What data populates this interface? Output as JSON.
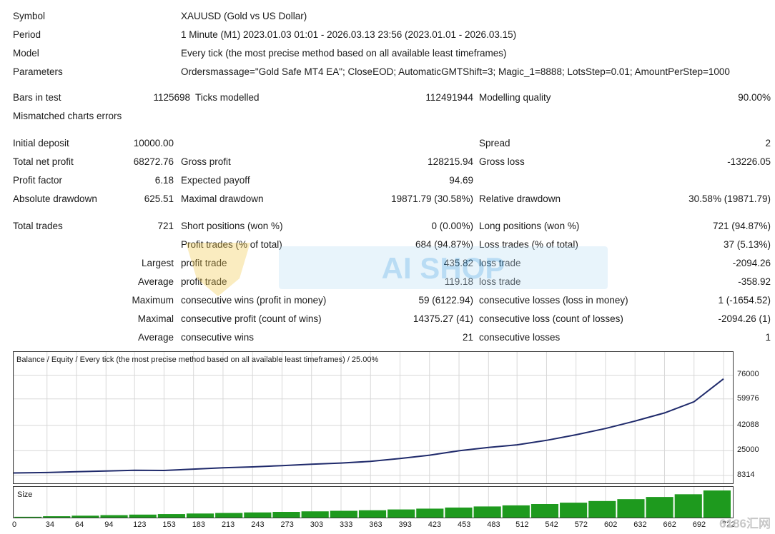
{
  "header": {
    "symbol_label": "Symbol",
    "symbol_value": "XAUUSD (Gold vs US Dollar)",
    "period_label": "Period",
    "period_value": "1 Minute (M1) 2023.01.03 01:01 - 2026.03.13 23:56 (2023.01.01 - 2026.03.15)",
    "model_label": "Model",
    "model_value": "Every tick (the most precise method based on all available least timeframes)",
    "parameters_label": "Parameters",
    "parameters_value": "Ordersmassage=\"Gold Safe MT4 EA\"; CloseEOD; AutomaticGMTShift=3; Magic_1=8888; LotsStep=0.01; AmountPerStep=1000"
  },
  "stats": {
    "bars_label": "Bars in test",
    "bars_value": "1125698",
    "ticks_label": "Ticks modelled",
    "ticks_value": "112491944",
    "quality_label": "Modelling quality",
    "quality_value": "90.00%",
    "mismatched_label": "Mismatched charts errors",
    "mismatched_value": "",
    "deposit_label": "Initial deposit",
    "deposit_value": "10000.00",
    "spread_label": "Spread",
    "spread_value": "2",
    "netprofit_label": "Total net profit",
    "netprofit_value": "68272.76",
    "grossprofit_label": "Gross profit",
    "grossprofit_value": "128215.94",
    "grossloss_label": "Gross loss",
    "grossloss_value": "-13226.05",
    "pf_label": "Profit factor",
    "pf_value": "6.18",
    "expected_label": "Expected payoff",
    "expected_value": "94.69",
    "absdd_label": "Absolute drawdown",
    "absdd_value": "625.51",
    "maxdd_label": "Maximal drawdown",
    "maxdd_value": "19871.79 (30.58%)",
    "reldd_label": "Relative drawdown",
    "reldd_value": "30.58% (19871.79)",
    "trades_label": "Total trades",
    "trades_value": "721",
    "short_label": "Short positions (won %)",
    "short_value": "0 (0.00%)",
    "long_label": "Long positions (won %)",
    "long_value": "721 (94.87%)",
    "pt_label": "Profit trades (% of total)",
    "pt_value": "684 (94.87%)",
    "lt_label": "Loss trades (% of total)",
    "lt_value": "37 (5.13%)",
    "largest_label": "Largest",
    "lp_label": "profit trade",
    "lp_value": "435.82",
    "ll_label": "loss trade",
    "ll_value": "-2094.26",
    "average_label": "Average",
    "ap_label": "profit trade",
    "ap_value": "119.18",
    "al_label": "loss trade",
    "al_value": "-358.92",
    "maximum_label": "Maximum",
    "mcw_label": "consecutive wins (profit in money)",
    "mcw_value": "59 (6122.94)",
    "mcl_label": "consecutive losses (loss in money)",
    "mcl_value": "1 (-1654.52)",
    "maximal_label": "Maximal",
    "mcp_label": "consecutive profit (count of wins)",
    "mcp_value": "14375.27 (41)",
    "mclc_label": "consecutive loss (count of losses)",
    "mclc_value": "-2094.26 (1)",
    "average2_label": "Average",
    "acw_label": "consecutive wins",
    "acw_value": "21",
    "acl_label": "consecutive losses",
    "acl_value": "1"
  },
  "watermark_text": "AI SHOP",
  "corner_watermark": "6186汇网",
  "chart_data": {
    "type": "line",
    "title": "Balance / Equity / Every tick (the most precise method based on all available least timeframes) / 25.00%",
    "balance_color": "#1f2a6b",
    "size_color": "#1e9a1e",
    "y_ticks": [
      8314,
      25000,
      42088,
      59976,
      76000
    ],
    "ylim": [
      4000,
      82000
    ],
    "x_ticks": [
      0,
      34,
      64,
      94,
      123,
      153,
      183,
      213,
      243,
      273,
      303,
      333,
      363,
      393,
      423,
      453,
      483,
      512,
      542,
      572,
      602,
      632,
      662,
      692,
      722
    ],
    "xlim": [
      0,
      730
    ],
    "series": [
      {
        "x": [
          0,
          34,
          64,
          94,
          123,
          153,
          183,
          213,
          243,
          273,
          303,
          333,
          363,
          393,
          423,
          453,
          483,
          512,
          542,
          572,
          602,
          632,
          662,
          692,
          722
        ],
        "values": [
          10000,
          10300,
          10900,
          11300,
          11800,
          11700,
          12600,
          13500,
          14100,
          15000,
          15900,
          16700,
          17800,
          19800,
          22000,
          25000,
          27200,
          29000,
          32000,
          35800,
          40000,
          45000,
          50500,
          58000,
          73500
        ]
      }
    ],
    "size_label": "Size",
    "size_values": [
      0.03,
      0.05,
      0.07,
      0.09,
      0.11,
      0.13,
      0.15,
      0.17,
      0.19,
      0.21,
      0.23,
      0.25,
      0.27,
      0.3,
      0.33,
      0.37,
      0.41,
      0.45,
      0.5,
      0.55,
      0.61,
      0.68,
      0.76,
      0.86,
      1.0
    ]
  }
}
